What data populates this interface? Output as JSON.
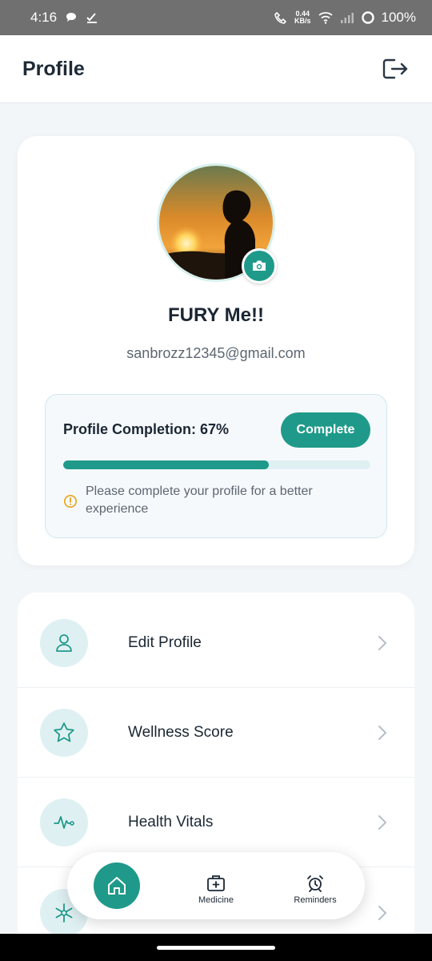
{
  "status_bar": {
    "time": "4:16",
    "speed_value": "0.44",
    "speed_unit": "KB/s",
    "battery": "100%"
  },
  "header": {
    "title": "Profile",
    "logout_icon": "logout-icon"
  },
  "profile": {
    "name": "FURY Me!!",
    "email": "sanbrozz12345@gmail.com",
    "camera_icon": "camera-icon"
  },
  "completion": {
    "label": "Profile Completion: 67%",
    "percent": 67,
    "button_label": "Complete",
    "hint": "Please complete your profile for a better experience"
  },
  "menu": {
    "items": [
      {
        "label": "Edit Profile",
        "icon": "user-icon"
      },
      {
        "label": "Wellness Score",
        "icon": "star-icon"
      },
      {
        "label": "Health Vitals",
        "icon": "heartbeat-icon"
      }
    ]
  },
  "bottom_nav": {
    "home_icon": "home-icon",
    "medicine_label": "Medicine",
    "reminders_label": "Reminders"
  },
  "colors": {
    "accent": "#1f9a8a",
    "icon_bg": "#dff0f3",
    "warning": "#e8a317"
  }
}
